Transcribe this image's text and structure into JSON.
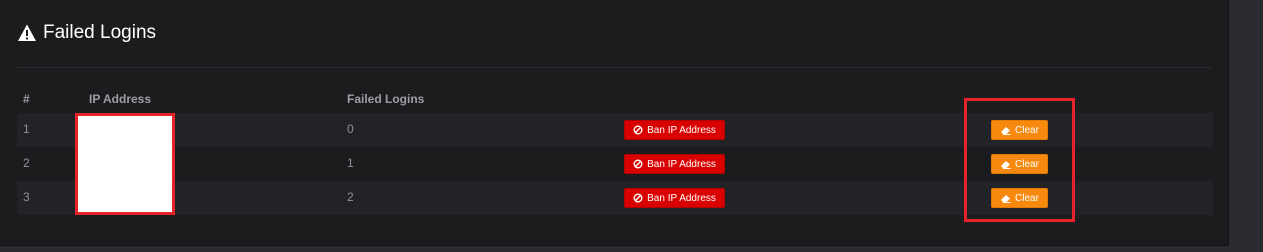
{
  "panel": {
    "title": "Failed Logins",
    "title_icon": "warning-triangle-icon"
  },
  "table": {
    "headers": [
      "#",
      "IP Address",
      "Failed Logins"
    ],
    "rows": [
      {
        "index": "1",
        "ip": "",
        "failed": "0",
        "ban_label": "Ban IP Address",
        "clear_label": "Clear"
      },
      {
        "index": "2",
        "ip": "",
        "failed": "1",
        "ban_label": "Ban IP Address",
        "clear_label": "Clear"
      },
      {
        "index": "3",
        "ip": "",
        "failed": "2",
        "ban_label": "Ban IP Address",
        "clear_label": "Clear"
      }
    ]
  },
  "icons": {
    "ban": "ban-icon",
    "clear": "eraser-icon"
  },
  "colors": {
    "ban_button": "#d80000",
    "clear_button": "#f78a0e",
    "annotation": "#e3242b"
  }
}
